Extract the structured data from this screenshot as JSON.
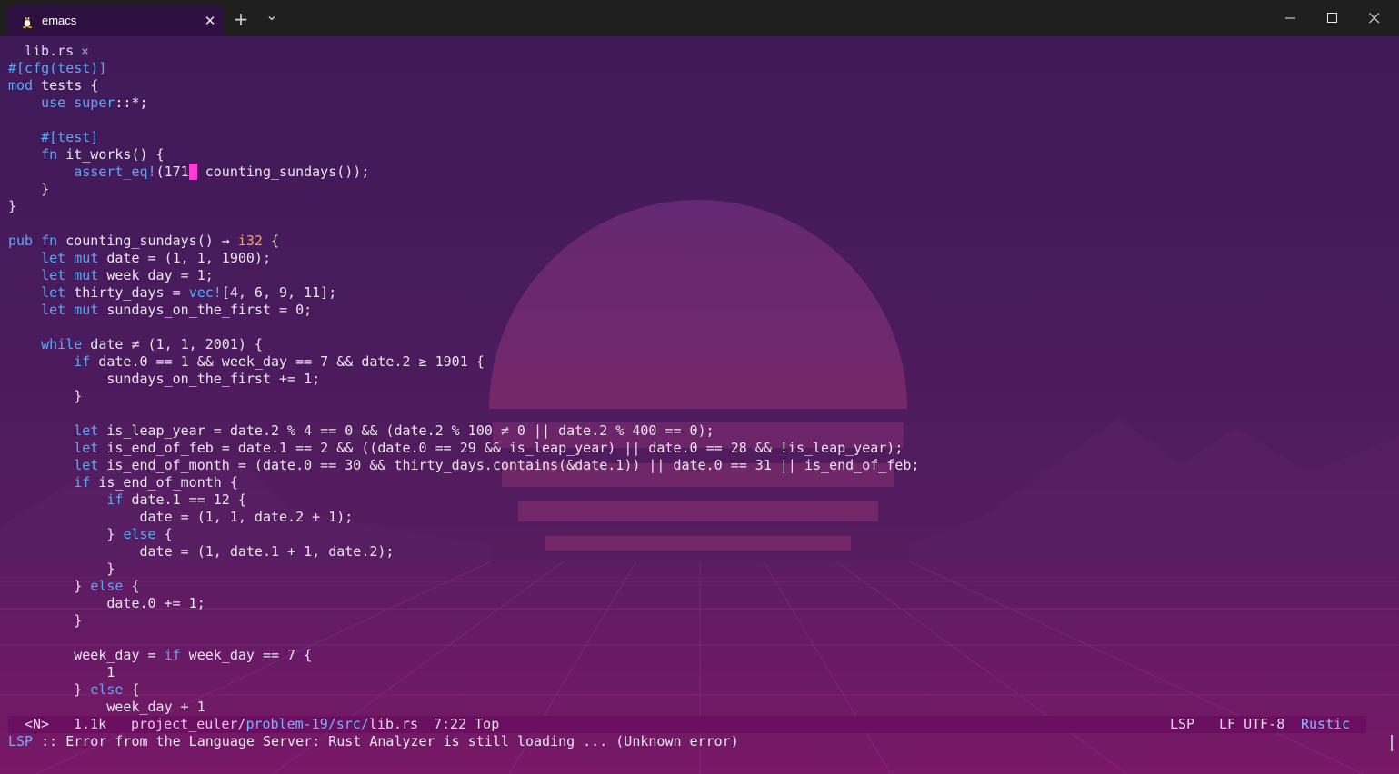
{
  "window": {
    "tab_title": "emacs",
    "tab_close": "✕",
    "new_tab": "+",
    "dropdown": "⌄",
    "icon": "tux-linux-icon"
  },
  "buffer": {
    "name": "lib.rs",
    "close": "×"
  },
  "code_lines": [
    [
      [
        "attr",
        "#[cfg(test)]"
      ]
    ],
    [
      [
        "kw",
        "mod"
      ],
      [
        "t",
        " tests {"
      ]
    ],
    [
      [
        "t",
        "    "
      ],
      [
        "kw",
        "use"
      ],
      [
        "t",
        " "
      ],
      [
        "kw",
        "super"
      ],
      [
        "t",
        "::*;"
      ]
    ],
    [
      [
        "t",
        ""
      ]
    ],
    [
      [
        "t",
        "    "
      ],
      [
        "attr",
        "#[test]"
      ]
    ],
    [
      [
        "t",
        "    "
      ],
      [
        "kw",
        "fn"
      ],
      [
        "t",
        " it_works() {"
      ]
    ],
    [
      [
        "t",
        "        "
      ],
      [
        "mac",
        "assert_eq!"
      ],
      [
        "t",
        "(171"
      ],
      [
        "cur",
        ","
      ],
      [
        "t",
        " counting_sundays());"
      ]
    ],
    [
      [
        "t",
        "    }"
      ]
    ],
    [
      [
        "t",
        "}"
      ]
    ],
    [
      [
        "t",
        ""
      ]
    ],
    [
      [
        "kw",
        "pub"
      ],
      [
        "t",
        " "
      ],
      [
        "kw",
        "fn"
      ],
      [
        "t",
        " counting_sundays() → "
      ],
      [
        "ty",
        "i32"
      ],
      [
        "t",
        " {"
      ]
    ],
    [
      [
        "t",
        "    "
      ],
      [
        "kw",
        "let"
      ],
      [
        "t",
        " "
      ],
      [
        "kw",
        "mut"
      ],
      [
        "t",
        " date = (1, 1, 1900);"
      ]
    ],
    [
      [
        "t",
        "    "
      ],
      [
        "kw",
        "let"
      ],
      [
        "t",
        " "
      ],
      [
        "kw",
        "mut"
      ],
      [
        "t",
        " week_day = 1;"
      ]
    ],
    [
      [
        "t",
        "    "
      ],
      [
        "kw",
        "let"
      ],
      [
        "t",
        " thirty_days = "
      ],
      [
        "mac",
        "vec!"
      ],
      [
        "t",
        "[4, 6, 9, 11];"
      ]
    ],
    [
      [
        "t",
        "    "
      ],
      [
        "kw",
        "let"
      ],
      [
        "t",
        " "
      ],
      [
        "kw",
        "mut"
      ],
      [
        "t",
        " sundays_on_the_first = 0;"
      ]
    ],
    [
      [
        "t",
        ""
      ]
    ],
    [
      [
        "t",
        "    "
      ],
      [
        "kw",
        "while"
      ],
      [
        "t",
        " date ≠ (1, 1, 2001) {"
      ]
    ],
    [
      [
        "t",
        "        "
      ],
      [
        "kw",
        "if"
      ],
      [
        "t",
        " date.0 == 1 && week_day == 7 && date.2 ≥ 1901 {"
      ]
    ],
    [
      [
        "t",
        "            sundays_on_the_first += 1;"
      ]
    ],
    [
      [
        "t",
        "        }"
      ]
    ],
    [
      [
        "t",
        ""
      ]
    ],
    [
      [
        "t",
        "        "
      ],
      [
        "kw",
        "let"
      ],
      [
        "t",
        " is_leap_year = date.2 % 4 == 0 && (date.2 % 100 ≠ 0 || date.2 % 400 == 0);"
      ]
    ],
    [
      [
        "t",
        "        "
      ],
      [
        "kw",
        "let"
      ],
      [
        "t",
        " is_end_of_feb = date.1 == 2 && ((date.0 == 29 && is_leap_year) || date.0 == 28 && !is_leap_year);"
      ]
    ],
    [
      [
        "t",
        "        "
      ],
      [
        "kw",
        "let"
      ],
      [
        "t",
        " is_end_of_month = (date.0 == 30 && thirty_days.contains(&date.1)) || date.0 == 31 || is_end_of_feb;"
      ]
    ],
    [
      [
        "t",
        "        "
      ],
      [
        "kw",
        "if"
      ],
      [
        "t",
        " is_end_of_month {"
      ]
    ],
    [
      [
        "t",
        "            "
      ],
      [
        "kw",
        "if"
      ],
      [
        "t",
        " date.1 == 12 {"
      ]
    ],
    [
      [
        "t",
        "                date = (1, 1, date.2 + 1);"
      ]
    ],
    [
      [
        "t",
        "            } "
      ],
      [
        "kw",
        "else"
      ],
      [
        "t",
        " {"
      ]
    ],
    [
      [
        "t",
        "                date = (1, date.1 + 1, date.2);"
      ]
    ],
    [
      [
        "t",
        "            }"
      ]
    ],
    [
      [
        "t",
        "        } "
      ],
      [
        "kw",
        "else"
      ],
      [
        "t",
        " {"
      ]
    ],
    [
      [
        "t",
        "            date.0 += 1;"
      ]
    ],
    [
      [
        "t",
        "        }"
      ]
    ],
    [
      [
        "t",
        ""
      ]
    ],
    [
      [
        "t",
        "        week_day = "
      ],
      [
        "kw",
        "if"
      ],
      [
        "t",
        " week_day == 7 {"
      ]
    ],
    [
      [
        "t",
        "            1"
      ]
    ],
    [
      [
        "t",
        "        } "
      ],
      [
        "kw",
        "else"
      ],
      [
        "t",
        " {"
      ]
    ],
    [
      [
        "t",
        "            week_day + 1"
      ]
    ]
  ],
  "modeline": {
    "state": "<N>",
    "size": "1.1k",
    "path_project": "project_euler/",
    "path_dir": "problem-19/src/",
    "path_file": "lib.rs",
    "position": "7:22 Top",
    "lsp": "LSP",
    "encoding": "LF UTF-8",
    "major_mode": "Rustic"
  },
  "minibuffer": {
    "prefix": "LSP",
    "message": " :: Error from the Language Server: Rust Analyzer is still loading ... (Unknown error)"
  },
  "colors": {
    "keyword": "#5aa8f5",
    "type": "#ff9d57",
    "cursor": "#ff3ad8",
    "modeline_bg": "#6a0f60"
  }
}
